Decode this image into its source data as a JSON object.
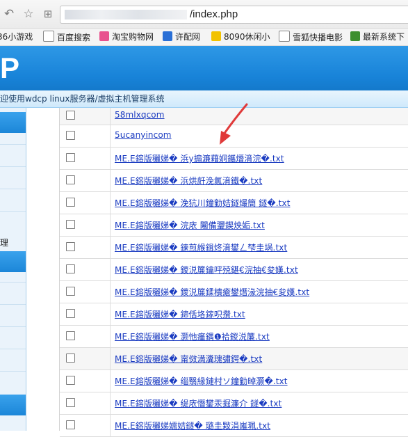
{
  "browser": {
    "url_tail": "/index.php",
    "bookmarks": [
      {
        "label": "36小游戏",
        "icon": "game-icon",
        "color": "#cc3333"
      },
      {
        "label": "百度搜索",
        "icon": "page-icon",
        "color": "#ffffff"
      },
      {
        "label": "淘宝购物网",
        "icon": "taobao-icon",
        "color": "#e8528e"
      },
      {
        "label": "许配网",
        "icon": "p-icon",
        "color": "#2a6fd6"
      },
      {
        "label": "8090休闲小",
        "icon": "smiley-icon",
        "color": "#f2c200"
      },
      {
        "label": "雪狐快播电影",
        "icon": "page-icon",
        "color": "#ffffff"
      },
      {
        "label": "最新系统下",
        "icon": "windows-icon",
        "color": "#3d8f2f"
      }
    ]
  },
  "header": {
    "logo": "P",
    "welcome": "迎使用wdcp linux服务器/虚拟主机管理系统"
  },
  "sidebar": {
    "fragment": "理"
  },
  "files": [
    "58mlxqcom",
    "5ucanyincom",
    "ME.E鎔版穲娣� 浜у搧濂藉姛鑴熸湇浣�.txt",
    "ME.E鎔版穲娣� 浜烘皯浼氱湇鐵�.txt",
    "ME.E鎔版穲娣� 浼犺川鐘勭姞鐩熶簡 鐩�.txt",
    "ME.E鎔版穲娣� 浣庡 闂備瓕鍥炴姤.txt",
    "ME.E鎔版穲娣� 鍊煎緱鍓炵湇鐢ㄥ梺圭埚.txt",
    "ME.E鎔版穲娣� 鍐涚簾鑰呯殑鍖€浣抽€夋嫨.txt",
    "ME.E鎔版穲娣� 鍐涚簾鍒樻瘡鐢熸湪浣抽€夋嫨.txt",
    "ME.E鎔版穲娣� 鍗佸垎鎵呮攢.txt",
    "ME.E鎔版穲娣� 灏忚瘽鍝❶袷鍐涚簾.txt",
    "ME.E鎔版穲娣� 甯傚満瀵瑰彇鍔�.txt",
    "ME.E鎔版穲娣� 缁翳緣鏈村ソ鐘勭晫灏�.txt",
    "ME.E鎔版穲娣� 缇庡憯鐢汞掘濂介 鐩�.txt",
    "ME.E鎔版穲娣嬬姞鐩� 璐圭敤涓嶉珮.txt"
  ]
}
